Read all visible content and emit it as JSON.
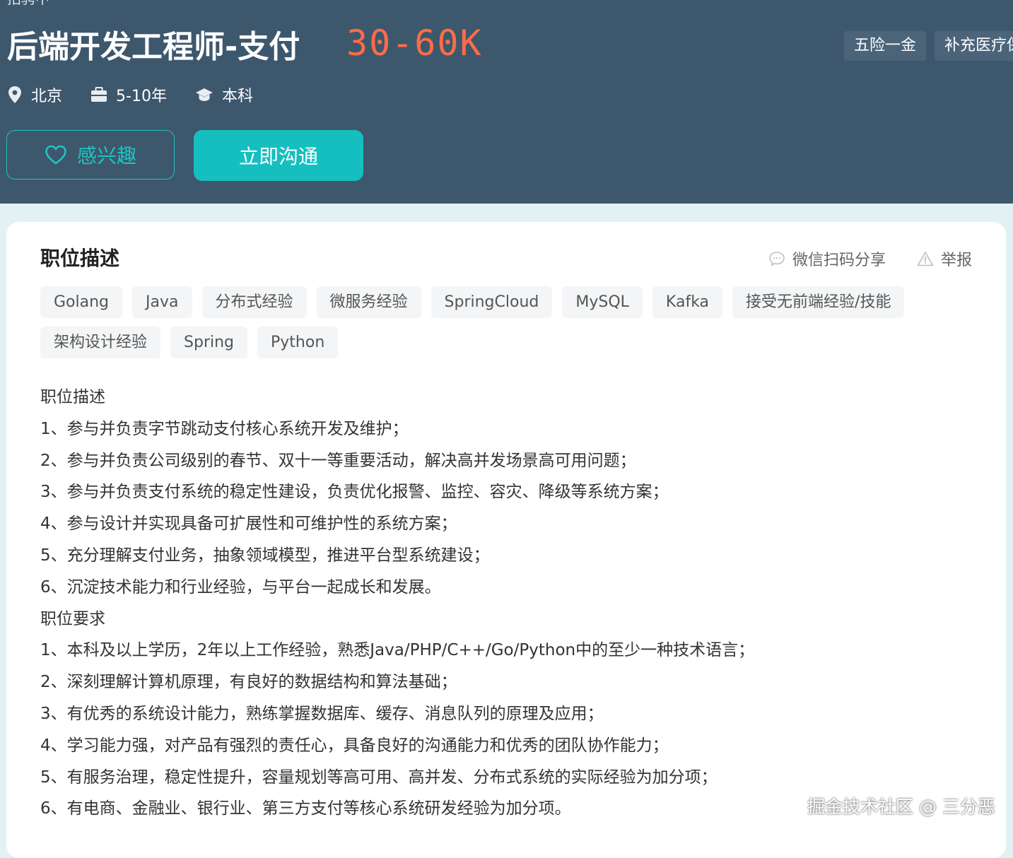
{
  "header": {
    "top_text": "招骋中",
    "job_title": "后端开发工程师-支付",
    "salary": "30-60K",
    "benefits": [
      "五险一金",
      "补充医疗保"
    ],
    "meta": {
      "location": "北京",
      "experience": "5-10年",
      "education": "本科"
    },
    "interest_label": "感兴趣",
    "chat_label": "立即沟通"
  },
  "card": {
    "title": "职位描述",
    "share_label": "微信扫码分享",
    "report_label": "举报",
    "tags": [
      "Golang",
      "Java",
      "分布式经验",
      "微服务经验",
      "SpringCloud",
      "MySQL",
      "Kafka",
      "接受无前端经验/技能",
      "架构设计经验",
      "Spring",
      "Python"
    ],
    "lines": [
      "职位描述",
      "1、参与并负责字节跳动支付核心系统开发及维护；",
      "2、参与并负责公司级别的春节、双十一等重要活动，解决高并发场景高可用问题；",
      "3、参与并负责支付系统的稳定性建设，负责优化报警、监控、容灾、降级等系统方案；",
      "4、参与设计并实现具备可扩展性和可维护性的系统方案；",
      "5、充分理解支付业务，抽象领域模型，推进平台型系统建设；",
      "6、沉淀技术能力和行业经验，与平台一起成长和发展。",
      "职位要求",
      "1、本科及以上学历，2年以上工作经验，熟悉Java/PHP/C++/Go/Python中的至少一种技术语言；",
      "2、深刻理解计算机原理，有良好的数据结构和算法基础；",
      "3、有优秀的系统设计能力，熟练掌握数据库、缓存、消息队列的原理及应用；",
      "4、学习能力强，对产品有强烈的责任心，具备良好的沟通能力和优秀的团队协作能力；",
      "5、有服务治理，稳定性提升，容量规划等高可用、高并发、分布式系统的实际经验为加分项；",
      "6、有电商、金融业、银行业、第三方支付等核心系统研发经验为加分项。"
    ]
  },
  "watermark": "掘金技术社区 @ 三分恶",
  "colors": {
    "header_bg": "#3d576d",
    "salary": "#ff6c45",
    "accent": "#16bfbf",
    "page_bg": "#e3f1f3"
  }
}
